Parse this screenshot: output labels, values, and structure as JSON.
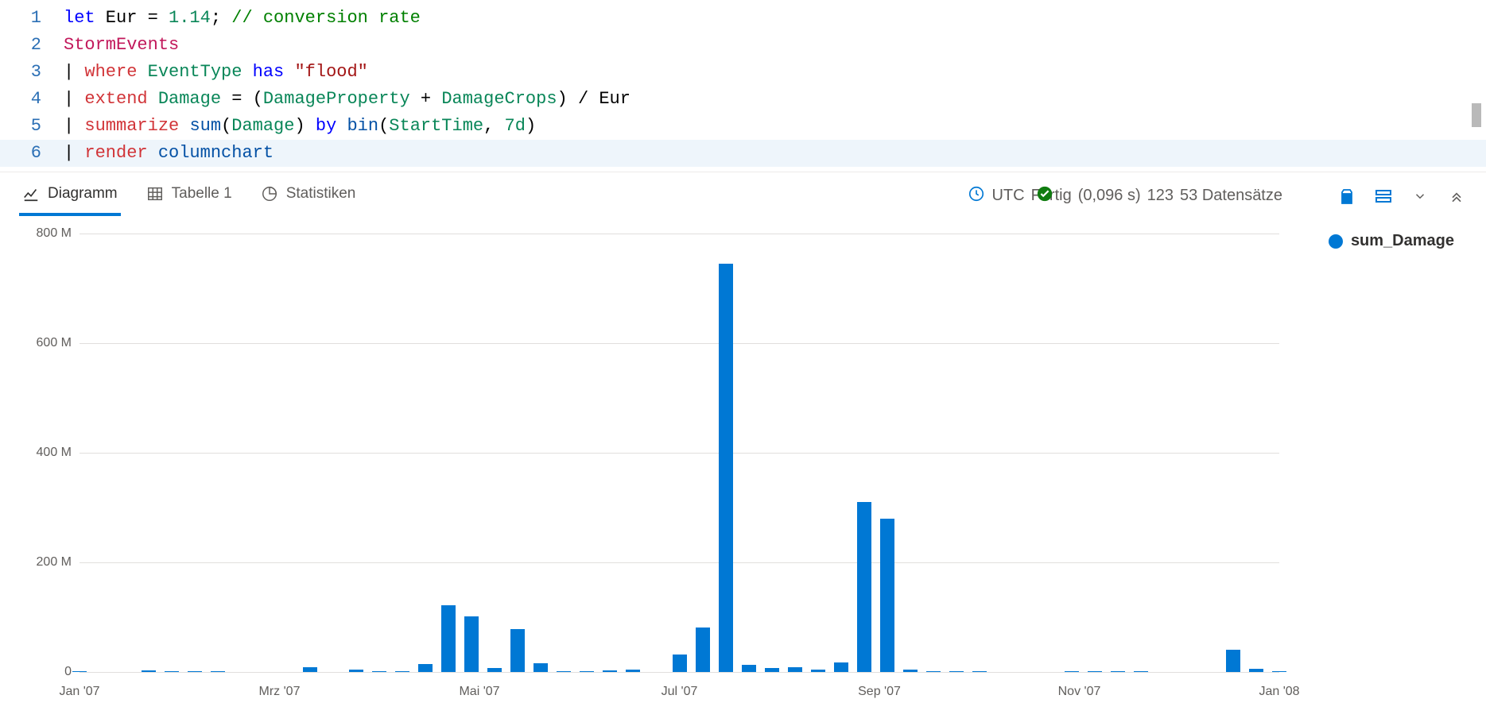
{
  "editor": {
    "lines": [
      {
        "n": "1",
        "tokens": [
          {
            "c": "kw",
            "t": "let"
          },
          {
            "c": "p",
            "t": " Eur "
          },
          {
            "c": "p",
            "t": "= "
          },
          {
            "c": "num",
            "t": "1.14"
          },
          {
            "c": "p",
            "t": "; "
          },
          {
            "c": "cmt",
            "t": "// conversion rate"
          }
        ]
      },
      {
        "n": "2",
        "tokens": [
          {
            "c": "tbl",
            "t": "StormEvents"
          }
        ]
      },
      {
        "n": "3",
        "tokens": [
          {
            "c": "p",
            "t": "| "
          },
          {
            "c": "op",
            "t": "where"
          },
          {
            "c": "p",
            "t": " "
          },
          {
            "c": "col",
            "t": "EventType"
          },
          {
            "c": "p",
            "t": " "
          },
          {
            "c": "kw",
            "t": "has"
          },
          {
            "c": "p",
            "t": " "
          },
          {
            "c": "str",
            "t": "\"flood\""
          }
        ]
      },
      {
        "n": "4",
        "tokens": [
          {
            "c": "p",
            "t": "| "
          },
          {
            "c": "op",
            "t": "extend"
          },
          {
            "c": "p",
            "t": " "
          },
          {
            "c": "col",
            "t": "Damage"
          },
          {
            "c": "p",
            "t": " = ("
          },
          {
            "c": "col",
            "t": "DamageProperty"
          },
          {
            "c": "p",
            "t": " + "
          },
          {
            "c": "col",
            "t": "DamageCrops"
          },
          {
            "c": "p",
            "t": ") / Eur"
          }
        ]
      },
      {
        "n": "5",
        "tokens": [
          {
            "c": "p",
            "t": "| "
          },
          {
            "c": "op",
            "t": "summarize"
          },
          {
            "c": "p",
            "t": " "
          },
          {
            "c": "fn",
            "t": "sum"
          },
          {
            "c": "p",
            "t": "("
          },
          {
            "c": "col",
            "t": "Damage"
          },
          {
            "c": "p",
            "t": ") "
          },
          {
            "c": "kw",
            "t": "by"
          },
          {
            "c": "p",
            "t": " "
          },
          {
            "c": "fn",
            "t": "bin"
          },
          {
            "c": "p",
            "t": "("
          },
          {
            "c": "col",
            "t": "StartTime"
          },
          {
            "c": "p",
            "t": ", "
          },
          {
            "c": "num",
            "t": "7d"
          },
          {
            "c": "p",
            "t": ")"
          }
        ]
      },
      {
        "n": "6",
        "highlight": true,
        "tokens": [
          {
            "c": "p",
            "t": "| "
          },
          {
            "c": "op",
            "t": "render"
          },
          {
            "c": "p",
            "t": " "
          },
          {
            "c": "fn",
            "t": "columnchart"
          }
        ]
      }
    ]
  },
  "tabs": {
    "chart": "Diagramm",
    "table": "Tabelle 1",
    "stats": "Statistiken"
  },
  "status": {
    "utc": "UTC",
    "ready": "Fertig",
    "duration": "(0,096 s)",
    "extra": "123",
    "rows": "53 Datensätze"
  },
  "legend": {
    "series": "sum_Damage"
  },
  "chart_data": {
    "type": "bar",
    "xlabel": "",
    "ylabel": "",
    "ylim": [
      0,
      800
    ],
    "y_ticks": [
      0,
      200,
      400,
      600,
      800
    ],
    "y_tick_labels": [
      "0",
      "200 M",
      "400 M",
      "600 M",
      "800 M"
    ],
    "x_ticks": [
      "Jan '07",
      "Mrz '07",
      "Mai '07",
      "Jul '07",
      "Sep '07",
      "Nov '07",
      "Jan '08"
    ],
    "categories_weeks_from_jan07": [
      0,
      1,
      2,
      3,
      4,
      5,
      6,
      7,
      8,
      9,
      10,
      11,
      12,
      13,
      14,
      15,
      16,
      17,
      18,
      19,
      20,
      21,
      22,
      23,
      24,
      25,
      26,
      27,
      28,
      29,
      30,
      31,
      32,
      33,
      34,
      35,
      36,
      37,
      38,
      39,
      40,
      41,
      42,
      43,
      44,
      45,
      46,
      47,
      48,
      49,
      50,
      51,
      52
    ],
    "values": [
      1,
      0,
      0,
      3,
      1,
      2,
      1,
      0,
      0,
      0,
      8,
      0,
      5,
      1,
      1,
      15,
      122,
      102,
      7,
      78,
      16,
      2,
      2,
      3,
      4,
      0,
      32,
      81,
      745,
      13,
      7,
      8,
      4,
      18,
      310,
      280,
      5,
      1,
      1,
      1,
      0,
      0,
      0,
      2,
      2,
      1,
      2,
      0,
      0,
      0,
      40,
      6,
      1
    ],
    "series": [
      {
        "name": "sum_Damage"
      }
    ],
    "units": "M"
  }
}
